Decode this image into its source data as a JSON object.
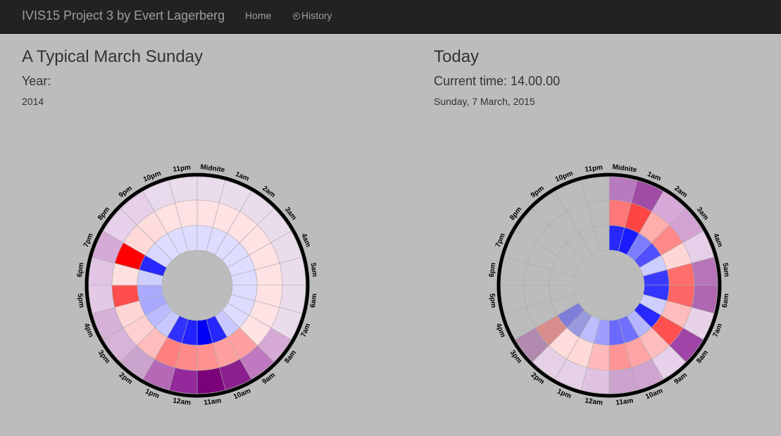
{
  "nav": {
    "brand": "IVIS15 Project 3 by Evert Lagerberg",
    "home": "Home",
    "history": "History"
  },
  "left": {
    "title": "A Typical March Sunday",
    "subtitle": "Year:",
    "sub_value": "2014"
  },
  "right": {
    "title": "Today",
    "subtitle": "Current time: 14.00.00",
    "sub_value": "Sunday, 7 March, 2015"
  },
  "hour_labels": [
    "Midnite",
    "1am",
    "2am",
    "3am",
    "4am",
    "5am",
    "6am",
    "7am",
    "8am",
    "9am",
    "10am",
    "11am",
    "12am",
    "1pm",
    "2pm",
    "3pm",
    "4pm",
    "5pm",
    "6pm",
    "7pm",
    "8pm",
    "9pm",
    "10pm",
    "11pm"
  ],
  "chart_data": [
    {
      "type": "heatmap",
      "title": "A Typical March Sunday",
      "layout": "radial, 24 hourly sectors, 3 rings",
      "categories": [
        "Midnite",
        "1am",
        "2am",
        "3am",
        "4am",
        "5am",
        "6am",
        "7am",
        "8am",
        "9am",
        "10am",
        "11am",
        "12am",
        "1pm",
        "2pm",
        "3pm",
        "4pm",
        "5pm",
        "6pm",
        "7pm",
        "8pm",
        "9pm",
        "10pm",
        "11pm"
      ],
      "rings": [
        {
          "name": "outer",
          "colors": [
            "#ebdcec",
            "#ebdcec",
            "#ebdcec",
            "#ebdcec",
            "#ebdcec",
            "#ebdcec",
            "#ebdcec",
            "#ebdcec",
            "#d6a9d6",
            "#bf79c0",
            "#8c1f8e",
            "#7a0179",
            "#93299a",
            "#b468b6",
            "#cba4cd",
            "#d7b3d7",
            "#d6b0d6",
            "#e4c9e6",
            "#e2c5e5",
            "#d6aad8",
            "#e7d0e9",
            "#e7cfe8",
            "#e9d9ec",
            "#ebdcec"
          ]
        },
        {
          "name": "middle",
          "colors": [
            "#ffe2e4",
            "#ffe2e4",
            "#ffe2e4",
            "#ffe2e4",
            "#ffe2e4",
            "#ffe2e4",
            "#ffe2e4",
            "#ffe2e4",
            "#ffe2e4",
            "#ff9f9f",
            "#ffa0a0",
            "#ff9090",
            "#ff8a8a",
            "#ff7f7f",
            "#ffbcbc",
            "#ffd0d0",
            "#ffd6d6",
            "#ff4c4c",
            "#ffe0e0",
            "#ff0000",
            "#ffd8d8",
            "#ffdcdc",
            "#ffe2e4",
            "#ffe2e4"
          ]
        },
        {
          "name": "inner",
          "colors": [
            "#dedcff",
            "#dedcff",
            "#dedcff",
            "#dedcff",
            "#dedcff",
            "#dedcff",
            "#dedcff",
            "#dedcff",
            "#dedcff",
            "#c8c8ff",
            "#2626ff",
            "#0000f4",
            "#2222ff",
            "#3030ff",
            "#c8c8ff",
            "#bbbbff",
            "#a8a8ff",
            "#aaaaff",
            "#cfcfff",
            "#2828ff",
            "#d8d8ff",
            "#dedcff",
            "#dedcff",
            "#dedcff"
          ]
        }
      ]
    },
    {
      "type": "heatmap",
      "title": "Today",
      "layout": "radial, 24 hourly sectors, 3 rings",
      "categories": [
        "Midnite",
        "1am",
        "2am",
        "3am",
        "4am",
        "5am",
        "6am",
        "7am",
        "8am",
        "9am",
        "10am",
        "11am",
        "12am",
        "1pm",
        "2pm",
        "3pm",
        "4pm",
        "5pm",
        "6pm",
        "7pm",
        "8pm",
        "9pm",
        "10pm",
        "11pm"
      ],
      "rings": [
        {
          "name": "outer",
          "colors": [
            "#b979bf",
            "#a14ca7",
            "#d8a8d8",
            "#d3a2d3",
            "#e8cfe9",
            "#b774b8",
            "#ae66b0",
            "#e7d2e9",
            "#a044a8",
            "#e7d0e9",
            "#cfa4d1",
            "#cca2ce",
            "#e0c3e3",
            "#e6d0e7",
            "#e5d0e6",
            "#b28ab0",
            "#bcbcbc",
            "#bcbcbc",
            "#bcbcbc",
            "#bcbcbc",
            "#bcbcbc",
            "#bcbcbc",
            "#bcbcbc",
            "#bcbcbc"
          ]
        },
        {
          "name": "middle",
          "colors": [
            "#ff7777",
            "#ff4444",
            "#ffadad",
            "#ff8888",
            "#ffd6d6",
            "#ff6d6d",
            "#ff6666",
            "#ffbcbc",
            "#ff5050",
            "#ffbcbc",
            "#ffa4a4",
            "#ff9494",
            "#ffbbbb",
            "#ffd8d8",
            "#ffdcdc",
            "#d98e8e",
            "#bcbcbc",
            "#bcbcbc",
            "#bcbcbc",
            "#bcbcbc",
            "#bcbcbc",
            "#bcbcbc",
            "#bcbcbc",
            "#bcbcbc"
          ]
        },
        {
          "name": "inner",
          "colors": [
            "#2828ff",
            "#1a1aff",
            "#7c7cff",
            "#5050ff",
            "#ccccff",
            "#3a3aff",
            "#3434ff",
            "#cfcfff",
            "#2828ff",
            "#b4b4ff",
            "#7070ff",
            "#6a6aff",
            "#9e9eff",
            "#bebeff",
            "#9999e0",
            "#7e7ed8",
            "#bcbcbc",
            "#bcbcbc",
            "#bcbcbc",
            "#bcbcbc",
            "#bcbcbc",
            "#bcbcbc",
            "#bcbcbc",
            "#bcbcbc"
          ]
        }
      ]
    }
  ]
}
